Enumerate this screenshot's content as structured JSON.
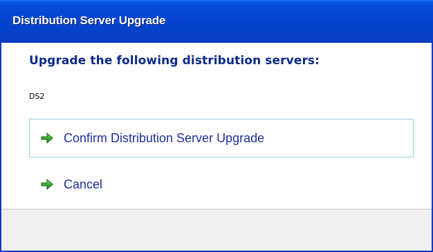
{
  "window": {
    "title": "Distribution Server Upgrade"
  },
  "main": {
    "heading": "Upgrade the following distribution servers:",
    "servers": [
      "DS2"
    ]
  },
  "actions": {
    "confirm": {
      "label": "Confirm Distribution Server Upgrade",
      "icon": "green-arrow-icon"
    },
    "cancel": {
      "label": "Cancel",
      "icon": "green-arrow-icon"
    }
  },
  "colors": {
    "titlebar": "#0548d4",
    "heading": "#0b2a8a",
    "link": "#1d2f9c",
    "arrow": "#2ea52e",
    "confirm_border": "#9ccbe0"
  }
}
